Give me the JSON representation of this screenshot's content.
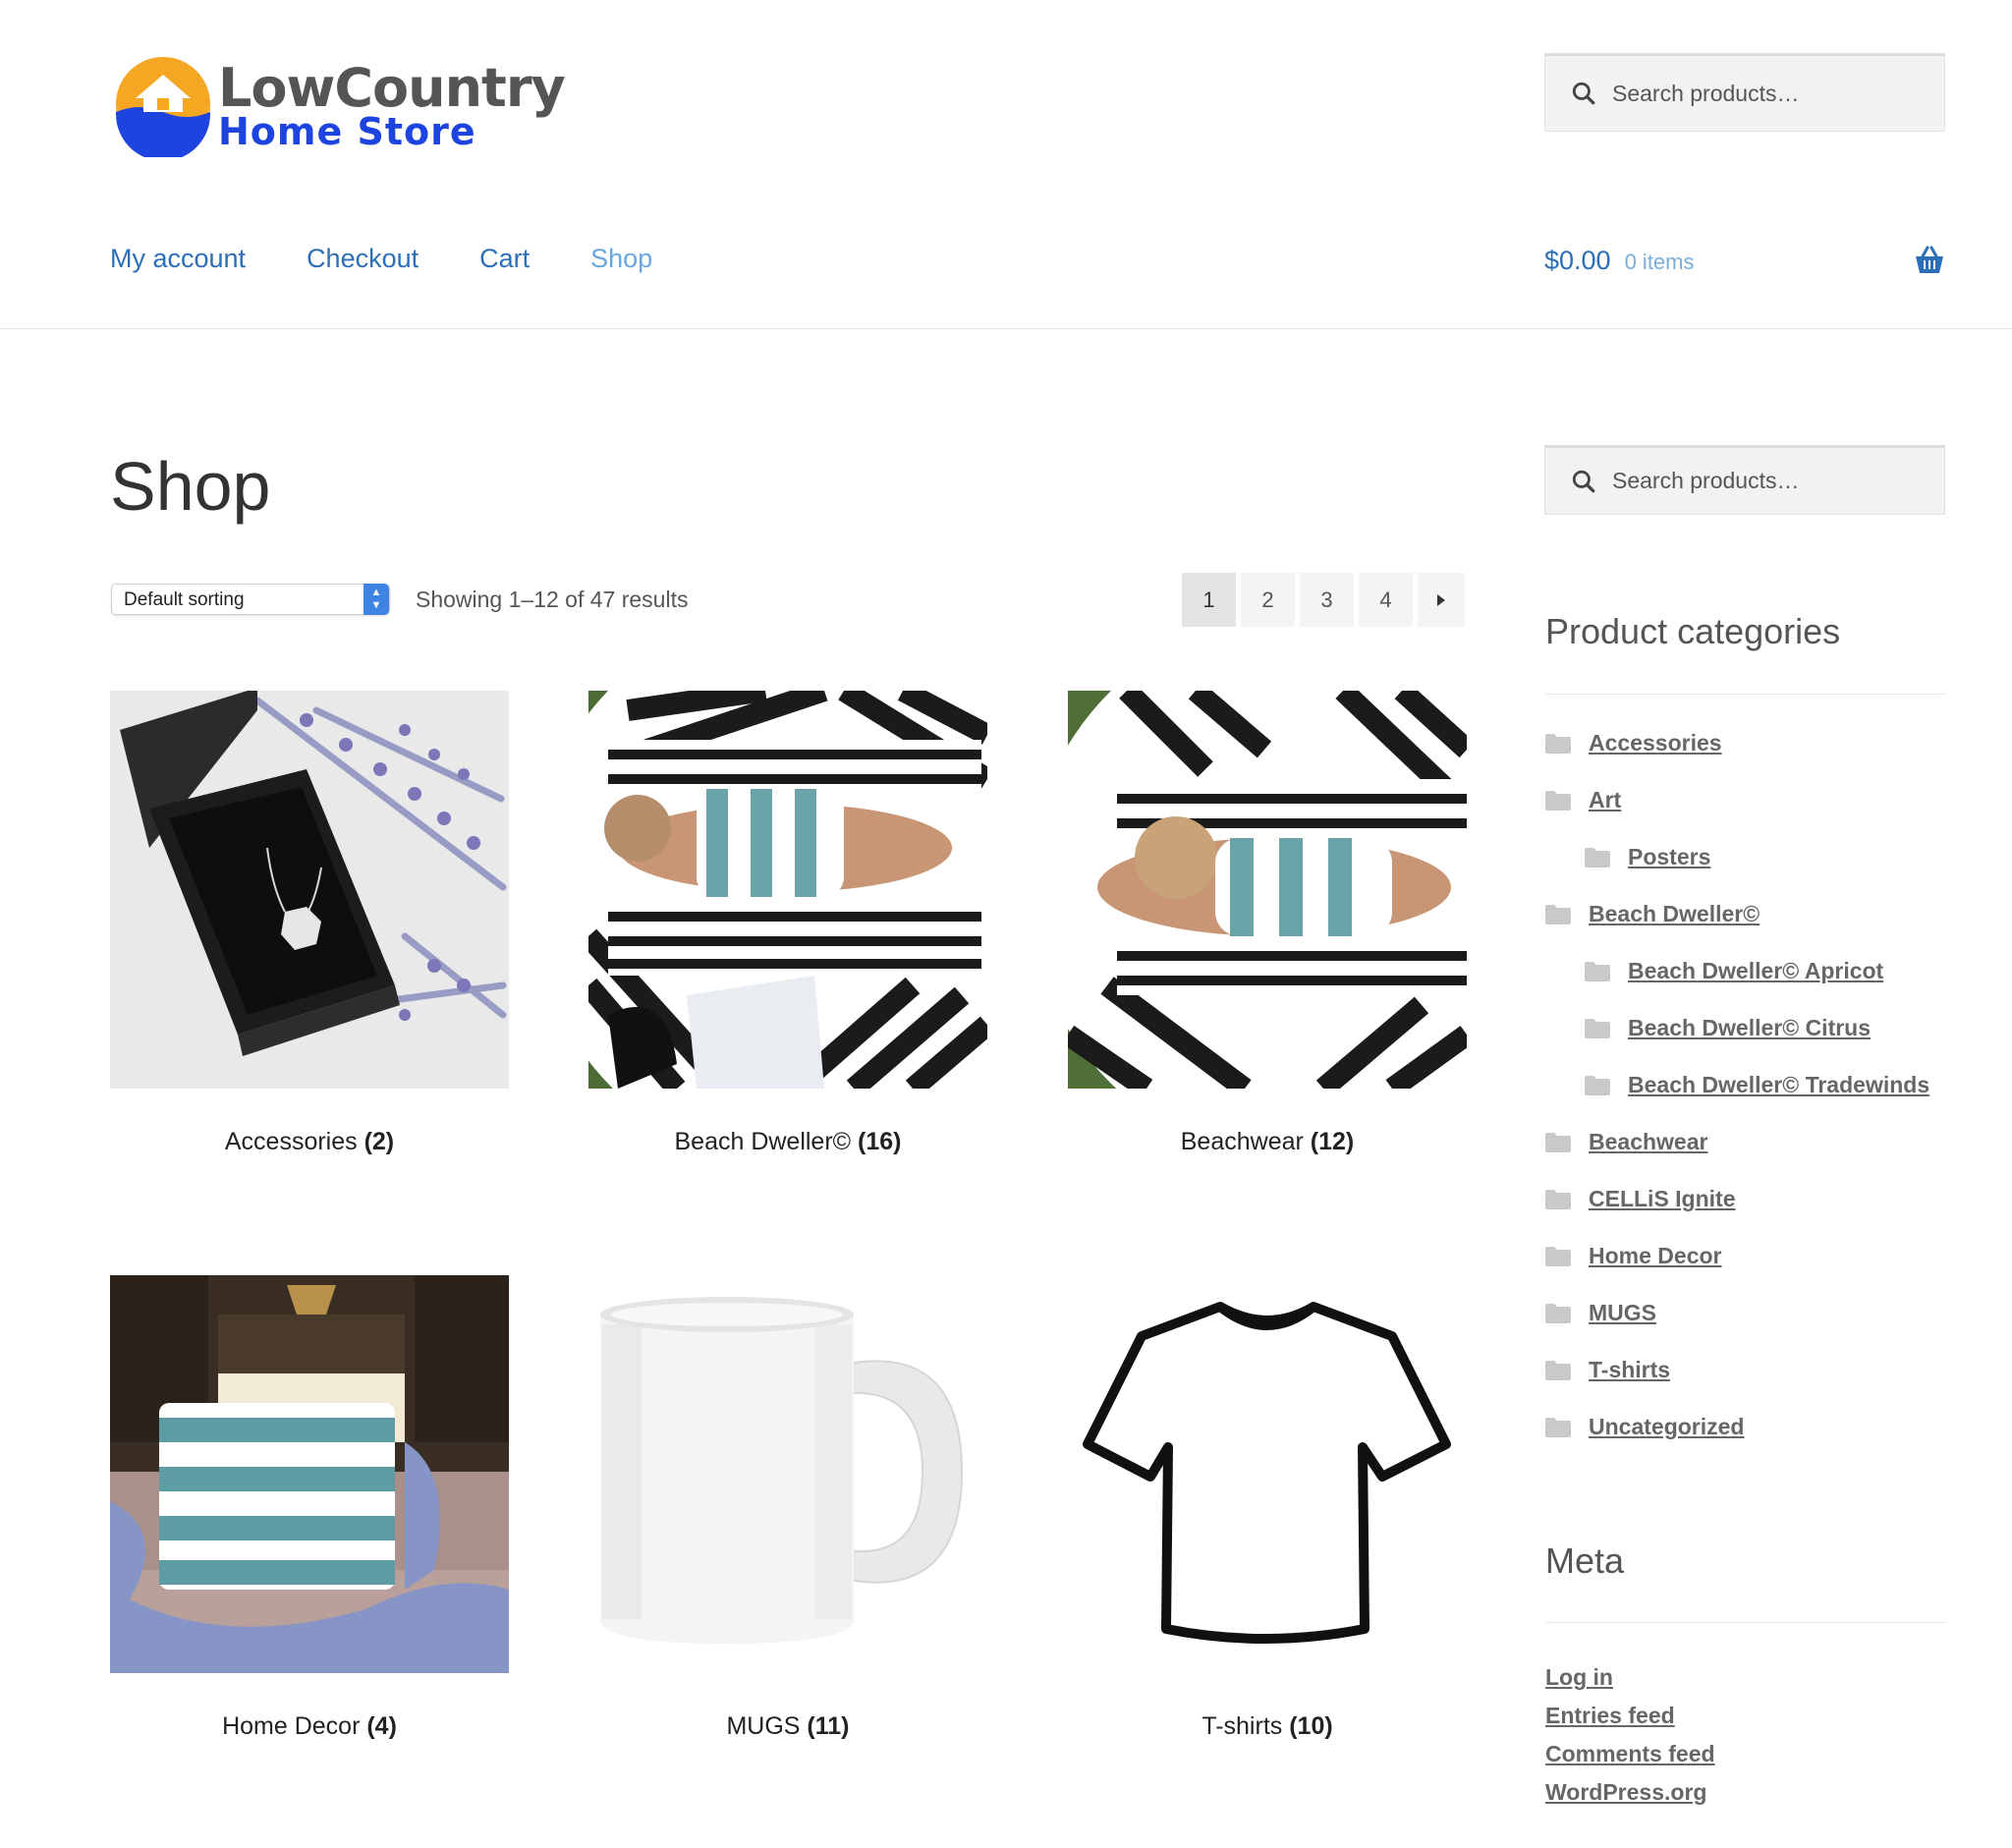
{
  "brand": {
    "title": "LowCountry",
    "subtitle": "Home Store"
  },
  "search": {
    "placeholder": "Search products…"
  },
  "nav": [
    "My account",
    "Checkout",
    "Cart",
    "Shop"
  ],
  "cart": {
    "amount": "$0.00",
    "count": "0 items"
  },
  "page": {
    "title": "Shop",
    "sorting": "Default sorting",
    "results": "Showing 1–12 of 47 results"
  },
  "pagination": [
    "1",
    "2",
    "3",
    "4"
  ],
  "products": [
    {
      "name": "Accessories",
      "count": "(2)"
    },
    {
      "name": "Beach Dweller©",
      "count": "(16)"
    },
    {
      "name": "Beachwear",
      "count": "(12)"
    },
    {
      "name": "Home Decor",
      "count": "(4)"
    },
    {
      "name": "MUGS",
      "count": "(11)"
    },
    {
      "name": "T-shirts",
      "count": "(10)"
    }
  ],
  "sidebar": {
    "categories_title": "Product categories",
    "categories": [
      {
        "label": "Accessories"
      },
      {
        "label": "Art"
      },
      {
        "label": "Posters"
      },
      {
        "label": "Beach Dweller©"
      },
      {
        "label": "Beach Dweller© Apricot"
      },
      {
        "label": "Beach Dweller© Citrus"
      },
      {
        "label": "Beach Dweller© Tradewinds"
      },
      {
        "label": "Beachwear"
      },
      {
        "label": "CELLiS Ignite"
      },
      {
        "label": "Home Decor"
      },
      {
        "label": "MUGS"
      },
      {
        "label": "T-shirts"
      },
      {
        "label": "Uncategorized"
      }
    ],
    "meta_title": "Meta",
    "meta_links": [
      "Log in",
      "Entries feed",
      "Comments feed",
      "WordPress.org"
    ]
  },
  "colors": {
    "link": "#2c6fb7",
    "link_current": "#6aa7de",
    "brand_blue": "#1e44e0",
    "brand_orange": "#f5a623"
  }
}
